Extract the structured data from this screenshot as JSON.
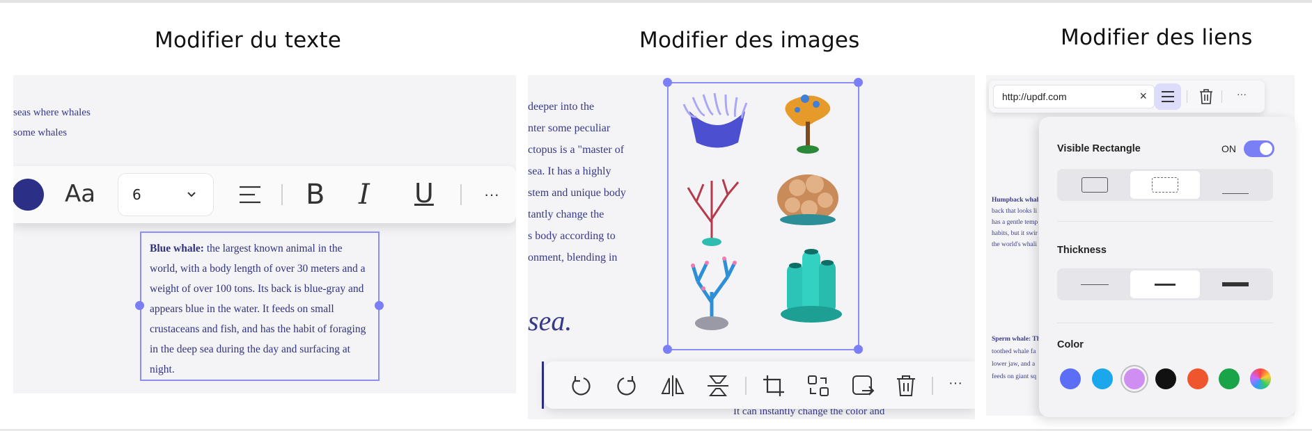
{
  "sections": {
    "text_title": "Modifier du texte",
    "images_title": "Modifier des images",
    "links_title": "Modifier des liens"
  },
  "text_panel": {
    "bg_lines": [
      "seas where whales",
      "some whales"
    ],
    "toolbar": {
      "color_swatch": "#2b2f86",
      "font_button": "Aa",
      "font_size": "6",
      "bold": "B",
      "italic": "I",
      "underline": "U",
      "more": "···"
    },
    "box": {
      "bold_lead": "Blue whale:",
      "body": " the largest known animal in the world, with a body length of over 30 meters and a weight of over 100 tons. Its back is blue-gray and appears blue in the water. It feeds on small crustaceans and fish, and has the habit of foraging in the deep sea during the day and surfacing at night."
    }
  },
  "image_panel": {
    "lines": [
      "deeper into the",
      "nter some peculiar",
      "ctopus is a \"master of",
      "sea. It has a highly",
      "stem and unique body",
      "tantly change the",
      "s body according to",
      "onment, blending in"
    ],
    "big_text": "sea.",
    "bottom_text": "It can instantly change the color and",
    "toolbar_more": "···",
    "icons": [
      "rotate-left",
      "rotate-right",
      "flip-horizontal",
      "flip-vertical",
      "crop",
      "replace",
      "extract",
      "delete"
    ]
  },
  "link_panel": {
    "url": "http://updf.com",
    "clear": "×",
    "more": "···",
    "doc_lines_top": [
      "Humpback whal",
      "back that looks li",
      "has a gentle temp",
      "habits, but it swir",
      "the world's whali"
    ],
    "doc_lines_bottom": [
      "Sperm whale: Th",
      "toothed whale fa",
      "lower jaw, and a",
      "feeds on giant sq"
    ],
    "visible_rectangle": {
      "label": "Visible Rectangle",
      "state": "ON"
    },
    "thickness_label": "Thickness",
    "color_label": "Color",
    "colors": [
      "#5b6ef5",
      "#1aa7ec",
      "#cf8ff2",
      "#111111",
      "#f0562e",
      "#1aa44a",
      "rainbow"
    ],
    "selected_color_index": 2,
    "accent": "#7b7ff5"
  }
}
